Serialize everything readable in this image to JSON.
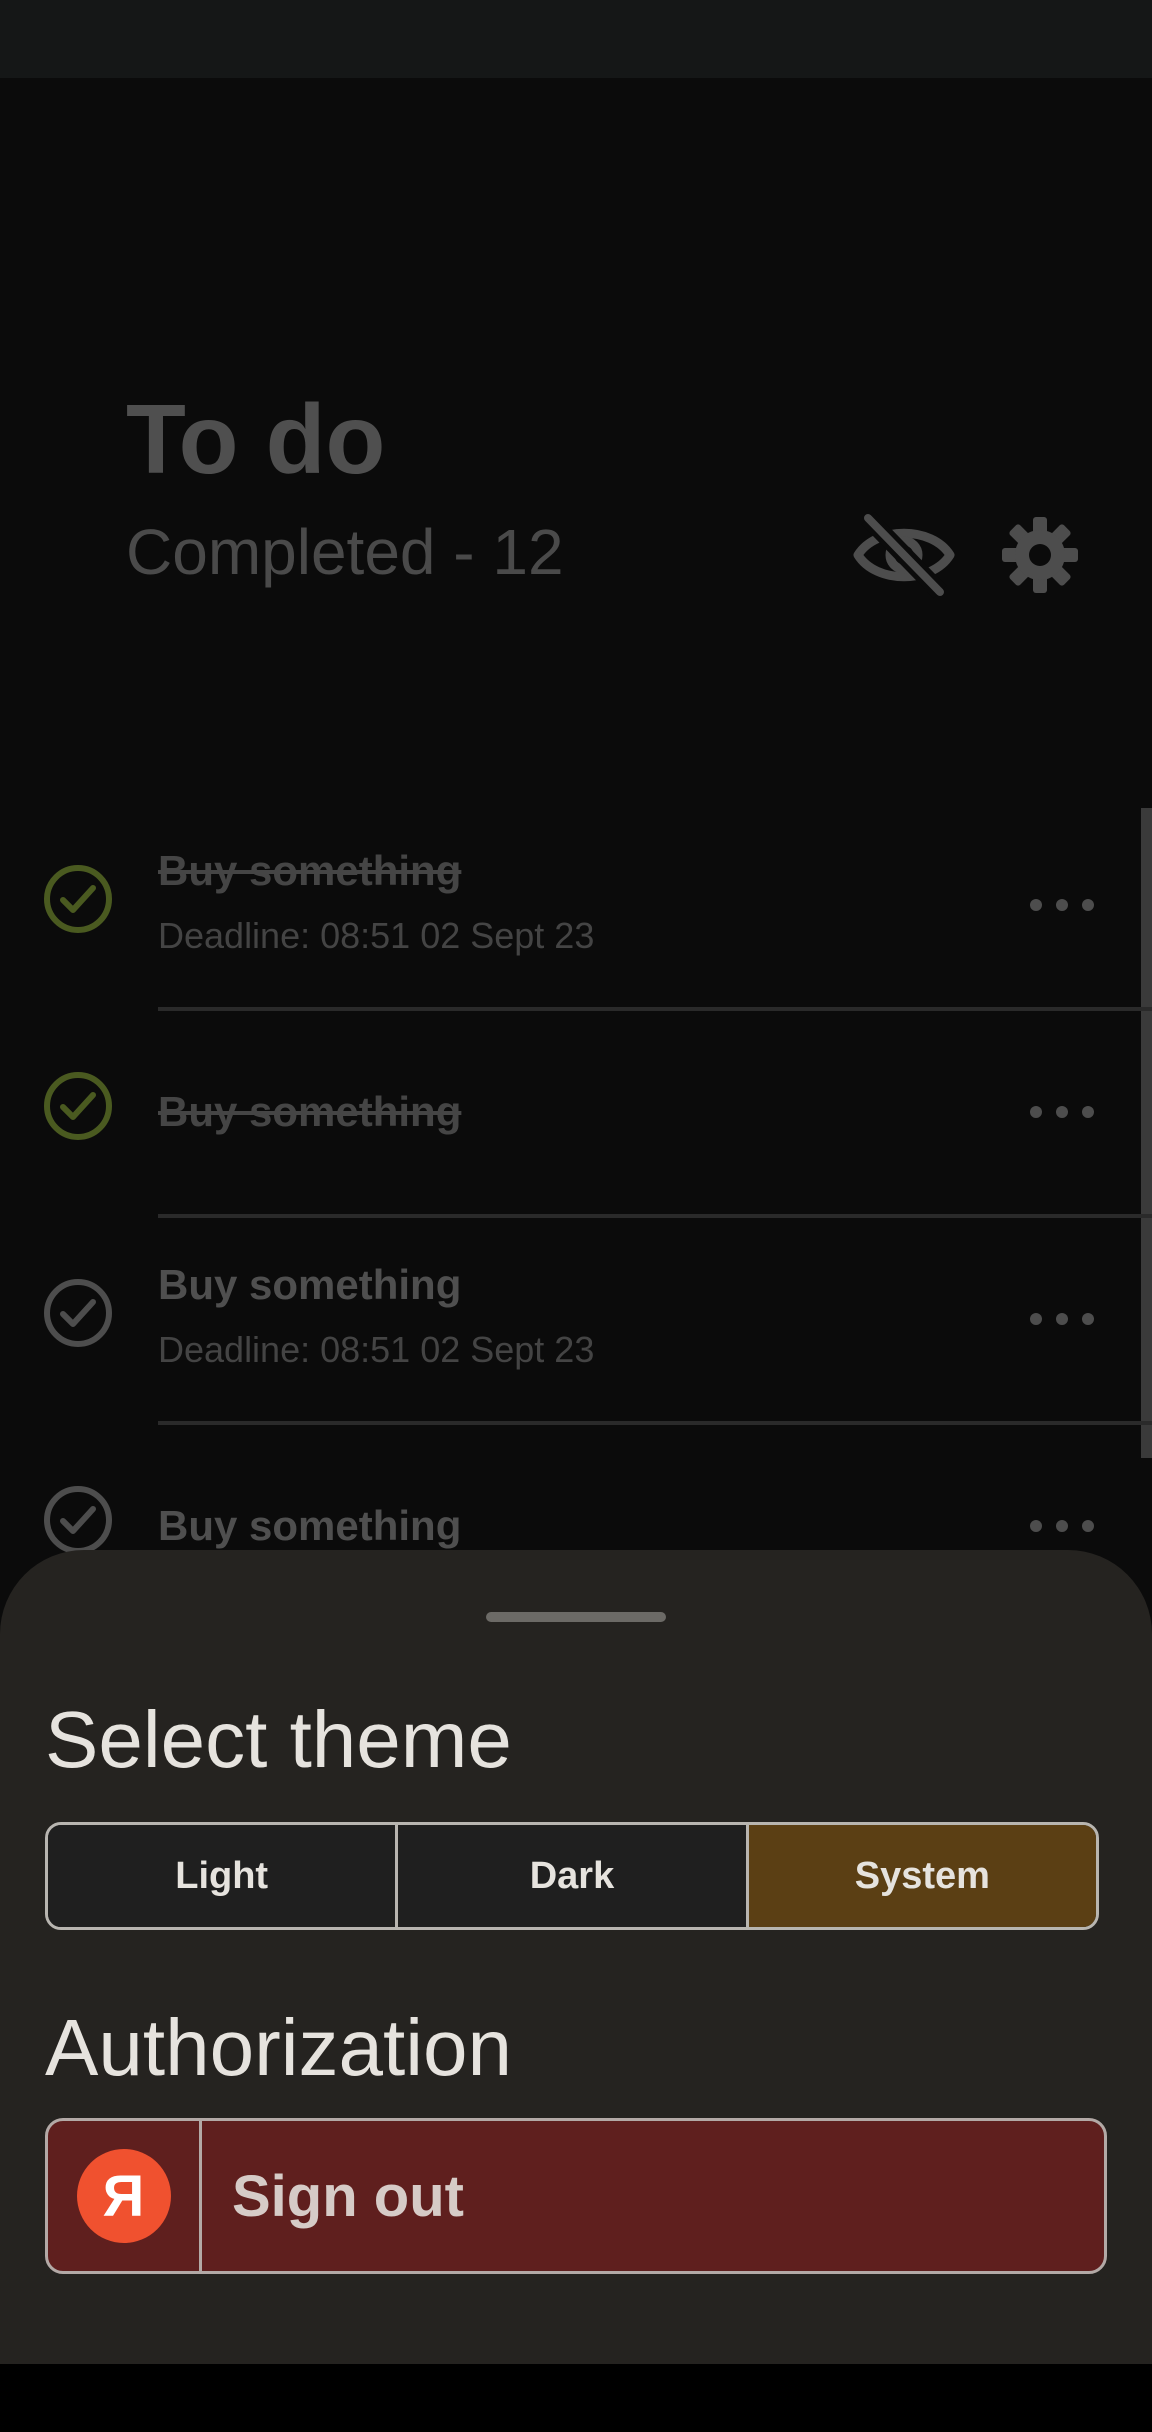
{
  "header": {
    "title": "To do",
    "completed_text": "Completed - 12"
  },
  "tasks": [
    {
      "title": "Buy something",
      "deadline": "Deadline: 08:51 02 Sept 23",
      "done": true
    },
    {
      "title": "Buy something",
      "deadline": "",
      "done": true
    },
    {
      "title": "Buy something",
      "deadline": "Deadline: 08:51 02 Sept 23",
      "done": false
    },
    {
      "title": "Buy something",
      "deadline": "",
      "done": false
    }
  ],
  "sheet": {
    "theme_heading": "Select theme",
    "theme_options": [
      "Light",
      "Dark",
      "System"
    ],
    "selected_theme": "System",
    "auth_heading": "Authorization",
    "logo_letter": "Я",
    "signout_label": "Sign out"
  },
  "colors": {
    "completed_check": "#4a5a20",
    "pending_check": "#4d4d4d",
    "selected_theme_bg": "#5b3f14",
    "signout_bg": "#5f1f1e",
    "yandex_red": "#f0512f"
  },
  "icons": [
    "eye-off-icon",
    "gear-icon",
    "check-circle-icon",
    "more-dots-icon",
    "yandex-logo"
  ]
}
